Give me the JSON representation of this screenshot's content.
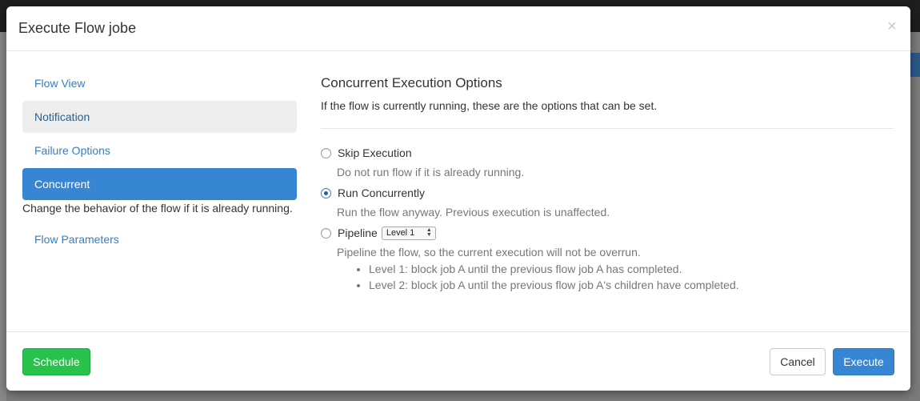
{
  "modal": {
    "title": "Execute Flow jobe",
    "close_glyph": "×"
  },
  "sidebar": {
    "items": [
      {
        "label": "Flow View"
      },
      {
        "label": "Notification"
      },
      {
        "label": "Failure Options"
      },
      {
        "label": "Concurrent"
      },
      {
        "label": "Flow Parameters"
      }
    ],
    "active_description": "Change the behavior of the flow if it is already running."
  },
  "main": {
    "title": "Concurrent Execution Options",
    "description": "If the flow is currently running, these are the options that can be set.",
    "options": [
      {
        "label": "Skip Execution",
        "checked": false,
        "description": "Do not run flow if it is already running."
      },
      {
        "label": "Run Concurrently",
        "checked": true,
        "description": "Run the flow anyway. Previous execution is unaffected."
      },
      {
        "label": "Pipeline",
        "checked": false,
        "description": "Pipeline the flow, so the current execution will not be overrun."
      }
    ],
    "pipeline_select": {
      "value": "Level 1"
    },
    "pipeline_levels": [
      "Level 1: block job A until the previous flow job A has completed.",
      "Level 2: block job A until the previous flow job A's children have completed."
    ]
  },
  "footer": {
    "schedule_label": "Schedule",
    "cancel_label": "Cancel",
    "execute_label": "Execute"
  },
  "colors": {
    "primary": "#3786d3",
    "success": "#27c24c",
    "link": "#3a7dbd"
  }
}
